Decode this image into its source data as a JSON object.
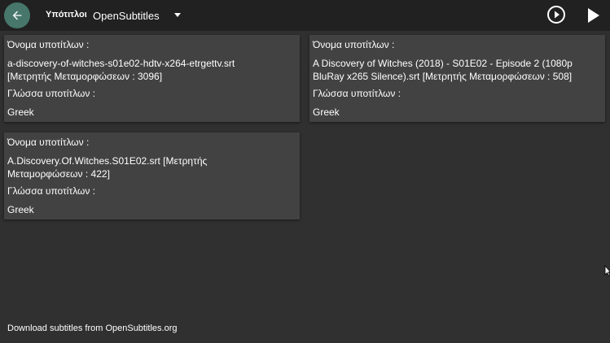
{
  "header": {
    "title": "Υπότιτλοι",
    "provider": "OpenSubtitles",
    "back_icon": "arrow-left-icon",
    "play_circle_icon": "play-circle-icon",
    "play_icon": "play-icon",
    "accent_color": "#47776b"
  },
  "cards": [
    {
      "name_label": "Όνομα υποτίτλων :",
      "name_lines": [
        "a-discovery-of-witches-s01e02-hdtv-x264-etrgettv.srt",
        "[Μετρητής Μεταμορφώσεων : 3096]"
      ],
      "language_label": "Γλώσσα υποτίτλων :",
      "language_value": "Greek"
    },
    {
      "name_label": "Όνομα υποτίτλων :",
      "name_lines": [
        "A Discovery of Witches (2018) - S01E02 - Episode 2 (1080p",
        "BluRay x265 Silence).srt [Μετρητής Μεταμορφώσεων : 508]"
      ],
      "language_label": "Γλώσσα υποτίτλων :",
      "language_value": "Greek"
    },
    {
      "name_label": "Όνομα υποτίτλων :",
      "name_lines": [
        "A.Discovery.Of.Witches.S01E02.srt [Μετρητής",
        "Μεταμορφώσεων : 422]"
      ],
      "language_label": "Γλώσσα υποτίτλων :",
      "language_value": "Greek"
    }
  ],
  "footer": {
    "text": "Download subtitles from OpenSubtitles.org"
  }
}
